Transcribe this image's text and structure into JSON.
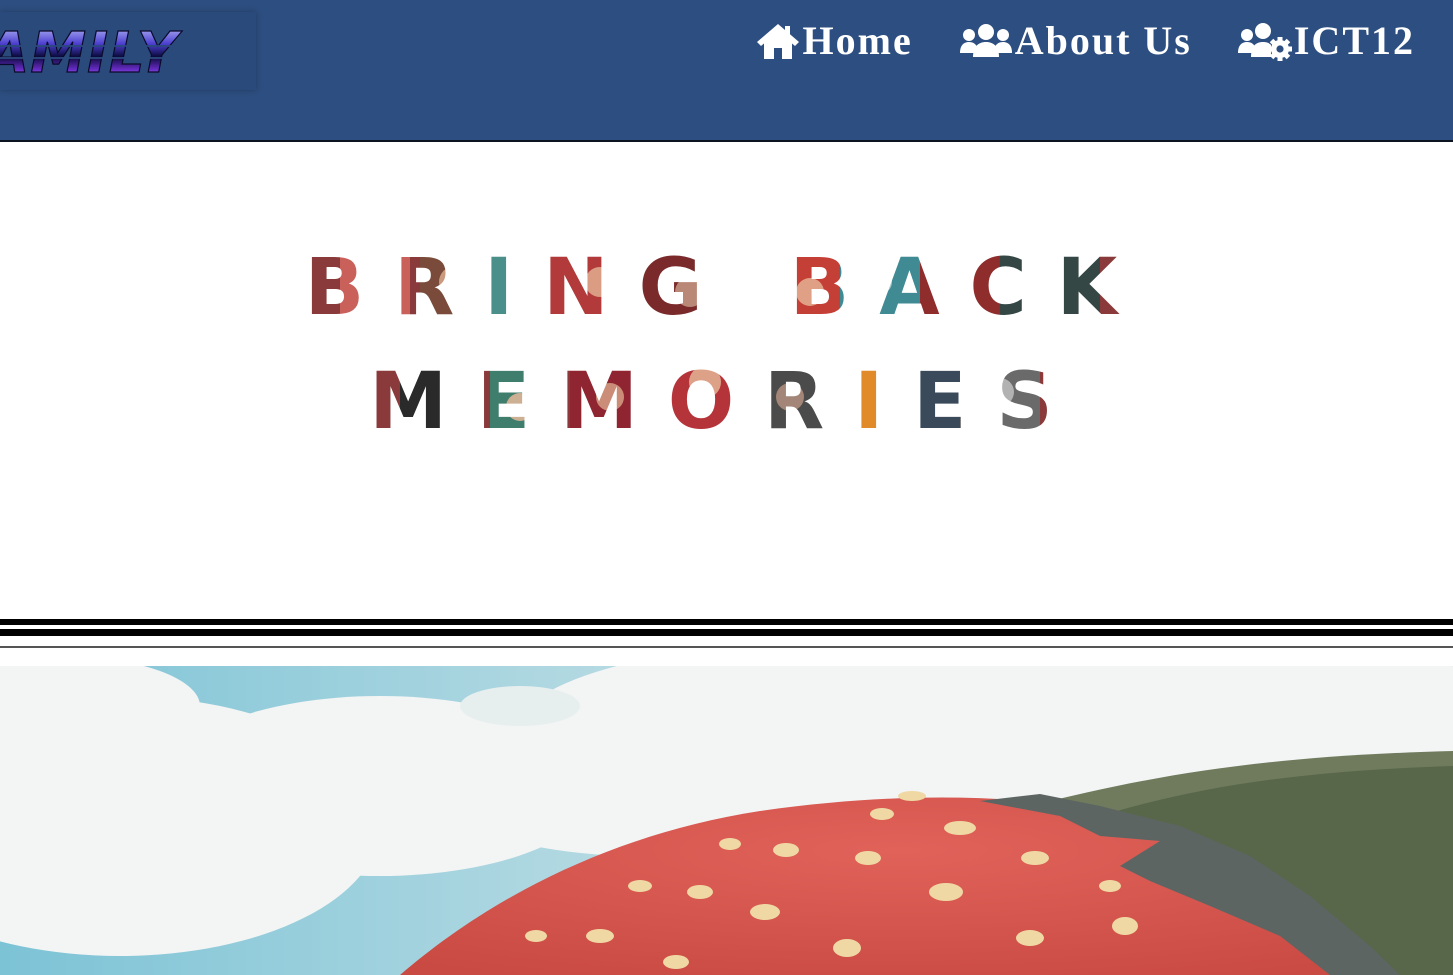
{
  "header": {
    "logo_text": "AMILY",
    "nav": [
      {
        "label": "Home",
        "icon": "home-icon"
      },
      {
        "label": "About Us",
        "icon": "users-icon"
      },
      {
        "label": "ICT12",
        "icon": "users-gear-icon"
      }
    ]
  },
  "hero": {
    "line1": "BRING BACK",
    "line2": "MEMORIES"
  },
  "banner": {
    "image": "giant-strawberry-landmark-photo"
  },
  "colors": {
    "header_bg": "#2d4e80",
    "nav_text": "#ffffff",
    "divider": "#000000",
    "strawberry_red": "#d4524a"
  }
}
